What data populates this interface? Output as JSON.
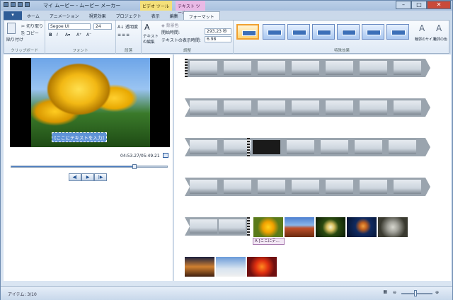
{
  "window": {
    "title": "マイ ムービー - ムービー メーカー"
  },
  "context_tabs": {
    "video": "ビデオ ツール",
    "text": "テキスト ツール"
  },
  "tabs": [
    "ホーム",
    "アニメーション",
    "視覚効果",
    "プロジェクト",
    "表示",
    "編集",
    "フォーマット"
  ],
  "active_tab": "フォーマット",
  "clipboard": {
    "paste": "貼り付け",
    "cut": "切り取り",
    "copy": "コピー",
    "group": "クリップボード"
  },
  "font": {
    "family": "Segoe UI",
    "size": "24",
    "group": "フォント"
  },
  "paragraph": {
    "transparency": "透明度",
    "group": "段落"
  },
  "adjust": {
    "edit_text": "テキストの編集",
    "bg_color": "背景色",
    "start_time_label": "開始時間:",
    "start_time": "293.23 秒",
    "duration_label": "テキストの表示時間:",
    "duration": "6.98",
    "group": "調整"
  },
  "effects": {
    "group": "特殊効果",
    "outline_size": "輪郭のサイズ",
    "outline_color": "輪郭の色"
  },
  "preview": {
    "overlay_text": "[ここにテキストを入力]",
    "timecode": "04:53.27/05:49.21",
    "progress": 0.79
  },
  "storyboard": {
    "caption": "A [ここにテ..."
  },
  "status": {
    "items": "アイテム: 3/10"
  },
  "colors": {
    "accent": "#2f5d98",
    "selected_effect": "#f0a030",
    "text_tab": "#e9b9e5",
    "video_tab": "#f4e07a"
  }
}
